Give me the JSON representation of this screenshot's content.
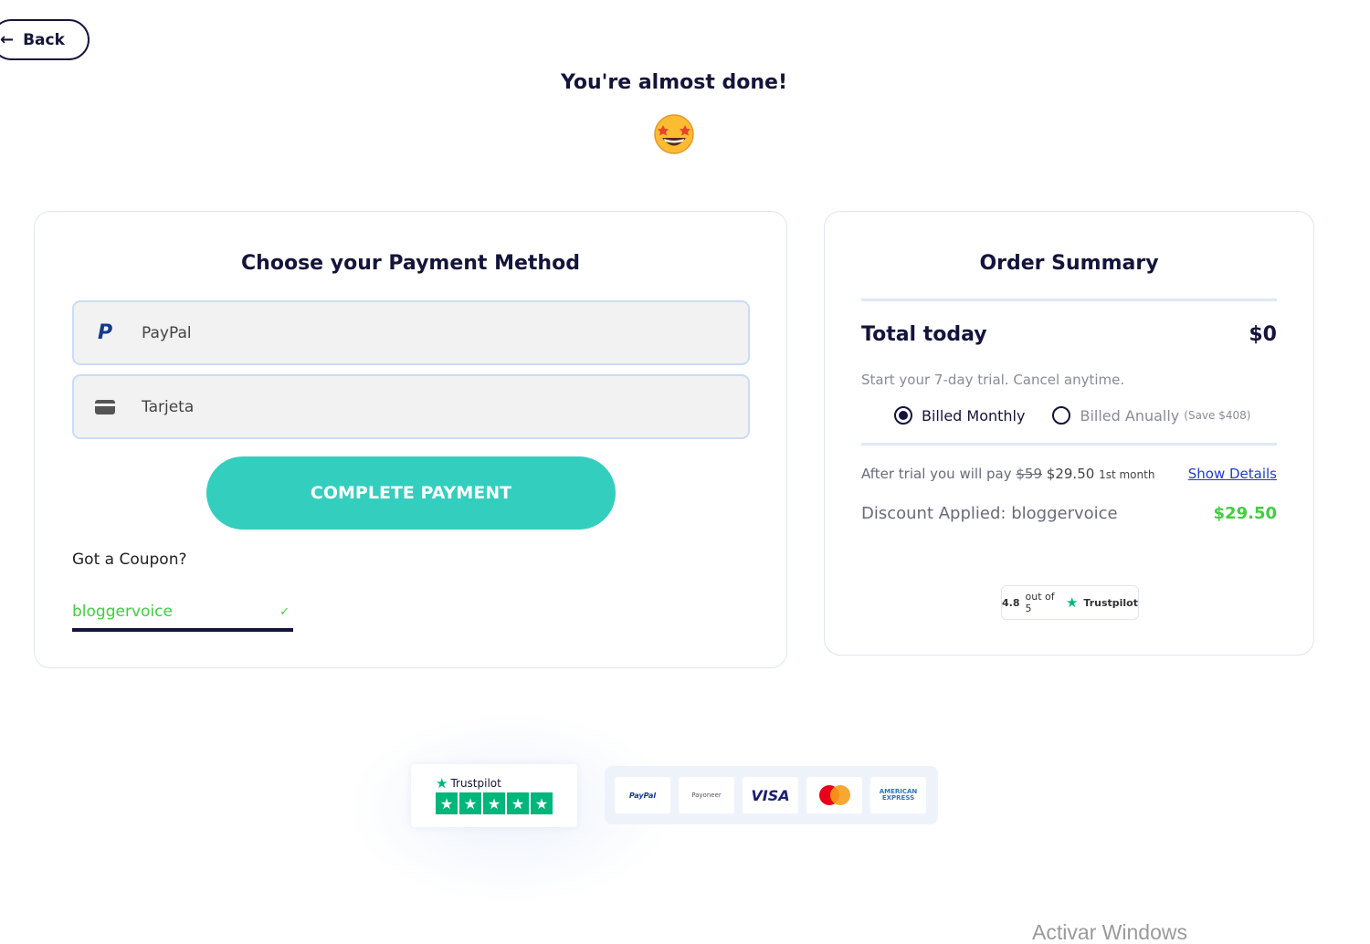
{
  "header": {
    "back_label": "Back",
    "headline": "You're almost done!"
  },
  "payment": {
    "title": "Choose your Payment Method",
    "methods": [
      {
        "label": "PayPal",
        "icon": "paypal-icon"
      },
      {
        "label": "Tarjeta",
        "icon": "credit-card-icon"
      }
    ],
    "complete_button": "COMPLETE PAYMENT",
    "coupon_question": "Got a Coupon?",
    "coupon_value": "bloggervoice",
    "coupon_check": "✓"
  },
  "summary": {
    "title": "Order Summary",
    "total_label": "Total today",
    "total_value": "$0",
    "trial_text": "Start your 7-day trial. Cancel anytime.",
    "billing_options": [
      {
        "label": "Billed Monthly",
        "note": "",
        "selected": true
      },
      {
        "label": "Billed Anually",
        "note": "(Save $408)",
        "selected": false
      }
    ],
    "after_trial_prefix": "After trial you will pay",
    "old_price": "$59",
    "new_price": "$29.50",
    "price_period": "1st month",
    "show_details": "Show Details",
    "discount_label": "Discount Applied: bloggervoice",
    "discount_value": "$29.50",
    "trustpilot_badge": {
      "rating": "4.8",
      "out_of": "out of 5",
      "brand": "Trustpilot"
    }
  },
  "footer": {
    "trustpilot_brand": "Trustpilot",
    "payment_logos": {
      "paypal": "PayPal",
      "payoneer": "Payoneer",
      "visa": "VISA",
      "mastercard": "MasterCard",
      "amex_line1": "AMERICAN",
      "amex_line2": "EXPRESS"
    }
  },
  "watermark": "Activar Windows",
  "colors": {
    "primary": "#33cebd",
    "navy": "#14143c",
    "success": "#3fcf3f",
    "link": "#1f3cc8",
    "trustpilot": "#00b67a"
  }
}
